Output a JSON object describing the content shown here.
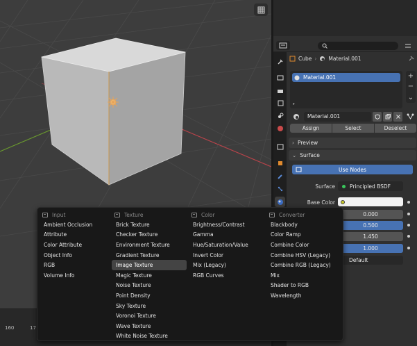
{
  "timeline": {
    "frames": [
      "160",
      "17"
    ]
  },
  "properties": {
    "search_placeholder": "",
    "breadcrumb": {
      "object": "Cube",
      "material": "Material.001"
    },
    "slots": [
      "Material.001"
    ],
    "side_buttons": [
      "+",
      "−",
      "⌄"
    ],
    "material_field": "Material.001",
    "actions": [
      "Assign",
      "Select",
      "Deselect"
    ],
    "panels": {
      "preview": "Preview",
      "surface": "Surface"
    },
    "use_nodes": "Use Nodes",
    "surface_label": "Surface",
    "surface_value": "Principled BSDF",
    "base_color_label": "Base Color",
    "values": [
      "0.000",
      "0.500",
      "1.450",
      "1.000"
    ],
    "default_value": "Default"
  },
  "add_menu": {
    "columns": [
      {
        "title": "Input",
        "items": [
          "Ambient Occlusion",
          "Attribute",
          "Color Attribute",
          "Object Info",
          "RGB",
          "Volume Info"
        ]
      },
      {
        "title": "Texture",
        "items": [
          "Brick Texture",
          "Checker Texture",
          "Environment Texture",
          "Gradient Texture",
          "Image Texture",
          "Magic Texture",
          "Noise Texture",
          "Point Density",
          "Sky Texture",
          "Voronoi Texture",
          "Wave Texture",
          "White Noise Texture"
        ],
        "highlighted": "Image Texture"
      },
      {
        "title": "Color",
        "items": [
          "Brightness/Contrast",
          "Gamma",
          "Hue/Saturation/Value",
          "Invert Color",
          "Mix (Legacy)",
          "RGB Curves"
        ]
      },
      {
        "title": "Converter",
        "items": [
          "Blackbody",
          "Color Ramp",
          "Combine Color",
          "Combine HSV (Legacy)",
          "Combine RGB (Legacy)",
          "Mix",
          "Shader to RGB",
          "Wavelength"
        ]
      }
    ]
  },
  "colors": {
    "accent": "#4772b3",
    "socket_yellow": "#c7c729",
    "socket_green": "#39c65b",
    "axis_red": "#b8434a",
    "axis_green": "#6a9a2e"
  }
}
